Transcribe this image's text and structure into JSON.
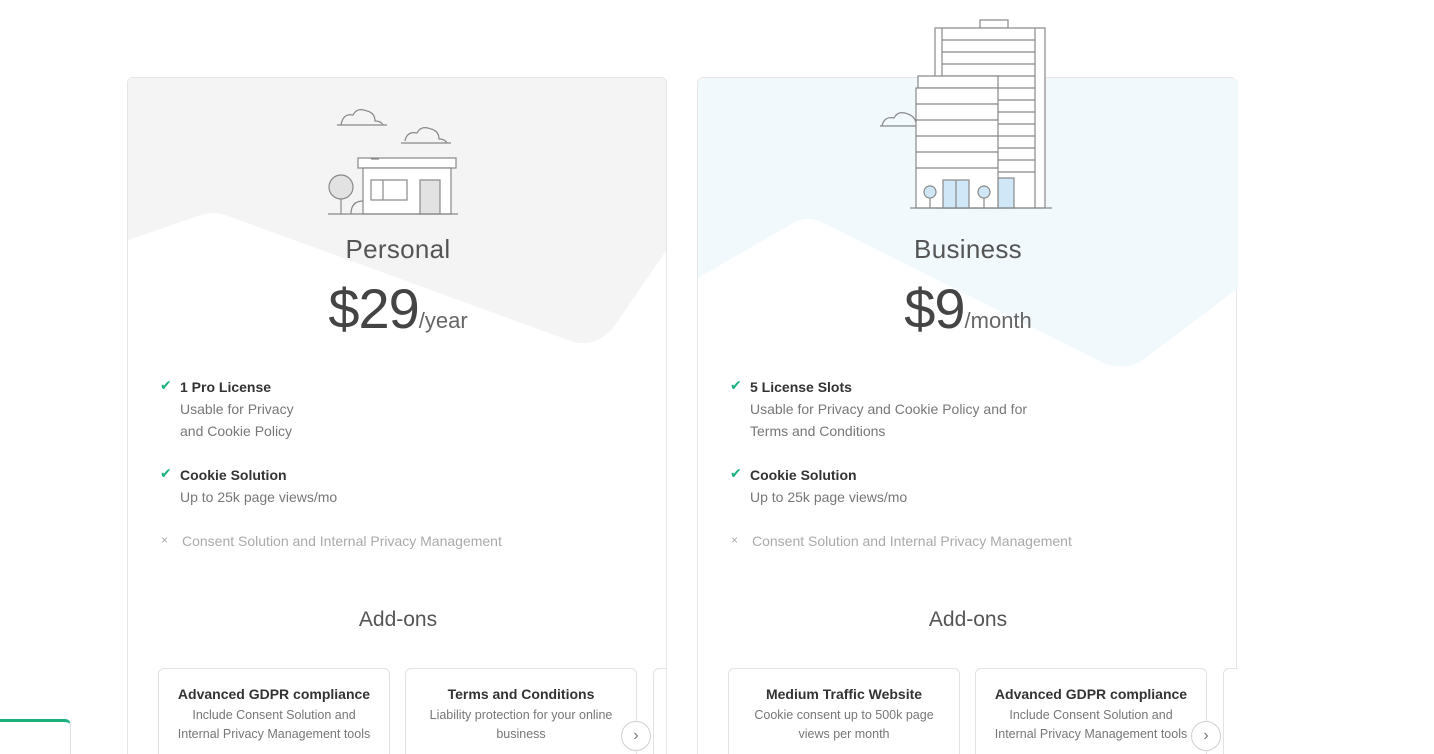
{
  "plans": [
    {
      "name": "Personal",
      "price": "$29",
      "period": "/year",
      "features": [
        {
          "title": "1 Pro License",
          "desc_lines": [
            "Usable for Privacy",
            "and Cookie Policy"
          ],
          "included": true
        },
        {
          "title": "Cookie Solution",
          "desc_lines": [
            "Up to 25k page views/mo"
          ],
          "included": true
        },
        {
          "title": "Consent Solution and Internal Privacy Management",
          "desc_lines": [],
          "included": false
        }
      ],
      "addons_title": "Add-ons",
      "addons": [
        {
          "title": "Advanced GDPR compliance",
          "desc": "Include Consent Solution and Internal Privacy Management tools"
        },
        {
          "title": "Terms and Conditions",
          "desc": "Liability protection for your online business"
        }
      ],
      "next_icon": "chevron-right-icon"
    },
    {
      "name": "Business",
      "price": "$9",
      "period": "/month",
      "features": [
        {
          "title": "5 License Slots",
          "desc_lines": [
            "Usable for Privacy and Cookie Policy and for",
            "Terms and Conditions"
          ],
          "included": true
        },
        {
          "title": "Cookie Solution",
          "desc_lines": [
            "Up to 25k page views/mo"
          ],
          "included": true
        },
        {
          "title": "Consent Solution and Internal Privacy Management",
          "desc_lines": [],
          "included": false
        }
      ],
      "addons_title": "Add-ons",
      "addons": [
        {
          "title": "Medium Traffic Website",
          "desc": "Cookie consent up to 500k page views per month"
        },
        {
          "title": "Advanced GDPR compliance",
          "desc": "Include Consent Solution and Internal Privacy Management tools"
        }
      ],
      "next_icon": "chevron-right-icon"
    }
  ],
  "icons": {
    "check": "✔",
    "cross": "×",
    "chevron": "›"
  },
  "colors": {
    "accent_green": "#1cb07a",
    "personal_bg": "#f4f4f4",
    "business_bg": "#f1f9fd",
    "window_blue": "#cfe7f7"
  }
}
